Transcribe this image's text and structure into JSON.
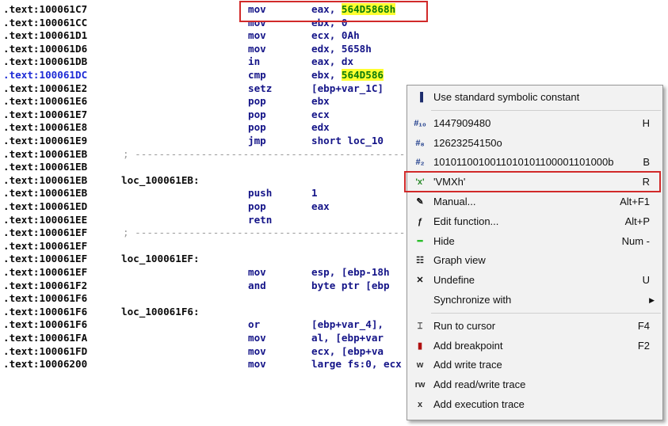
{
  "listing": [
    {
      "addr": ".text:100061C7",
      "mnem": "mov",
      "ops": "eax, ",
      "imm": "564D5868h",
      "hl": true
    },
    {
      "addr": ".text:100061CC",
      "mnem": "mov",
      "ops": "ebx, 0"
    },
    {
      "addr": ".text:100061D1",
      "mnem": "mov",
      "ops": "ecx, 0Ah"
    },
    {
      "addr": ".text:100061D6",
      "mnem": "mov",
      "ops": "edx, 5658h"
    },
    {
      "addr": ".text:100061DB",
      "mnem": "in",
      "ops": "eax, dx"
    },
    {
      "addr": ".text:100061DC",
      "mnem": "cmp",
      "ops": "ebx, ",
      "imm": "564D586",
      "hl": true,
      "current": true
    },
    {
      "addr": ".text:100061E2",
      "mnem": "setz",
      "ops": "[ebp+var_1C]"
    },
    {
      "addr": ".text:100061E6",
      "mnem": "pop",
      "ops": "ebx"
    },
    {
      "addr": ".text:100061E7",
      "mnem": "pop",
      "ops": "ecx"
    },
    {
      "addr": ".text:100061E8",
      "mnem": "pop",
      "ops": "edx"
    },
    {
      "addr": ".text:100061E9",
      "mnem": "jmp",
      "ops": "short loc_10"
    },
    {
      "addr": ".text:100061EB",
      "sep": "; ------------------------------------------------------"
    },
    {
      "addr": ".text:100061EB"
    },
    {
      "addr": ".text:100061EB",
      "label": "loc_100061EB:"
    },
    {
      "addr": ".text:100061EB",
      "mnem": "push",
      "ops": "1"
    },
    {
      "addr": ".text:100061ED",
      "mnem": "pop",
      "ops": "eax"
    },
    {
      "addr": ".text:100061EE",
      "mnem": "retn"
    },
    {
      "addr": ".text:100061EF",
      "sep": "; ------------------------------------------------------"
    },
    {
      "addr": ".text:100061EF"
    },
    {
      "addr": ".text:100061EF",
      "label": "loc_100061EF:"
    },
    {
      "addr": ".text:100061EF",
      "mnem": "mov",
      "ops": "esp, [ebp-18h"
    },
    {
      "addr": ".text:100061F2",
      "mnem": "and",
      "ops": "byte ptr [ebp"
    },
    {
      "addr": ".text:100061F6"
    },
    {
      "addr": ".text:100061F6",
      "label": "loc_100061F6:"
    },
    {
      "addr": ".text:100061F6",
      "mnem": "or",
      "ops": "[ebp+var_4], "
    },
    {
      "addr": ".text:100061FA",
      "mnem": "mov",
      "ops": "al, [ebp+var"
    },
    {
      "addr": ".text:100061FD",
      "mnem": "mov",
      "ops": "ecx, [ebp+va"
    },
    {
      "addr": ".text:10006200",
      "mnem": "mov",
      "ops": "large fs:0, ecx"
    }
  ],
  "menu": {
    "items": [
      {
        "name": "use-standard-symbolic-constant",
        "icon": "symbolic-constant-icon",
        "glyph": "▐",
        "color": "#1c2c6c",
        "label": "Use standard symbolic constant",
        "shortcut": ""
      },
      {
        "sep": true
      },
      {
        "name": "decimal",
        "icon": "decimal-icon",
        "glyph": "#₁₀",
        "color": "#1c3a8a",
        "label": "1447909480",
        "shortcut": "H"
      },
      {
        "name": "octal",
        "icon": "octal-icon",
        "glyph": "#₈",
        "color": "#1c3a8a",
        "label": "12623254150o",
        "shortcut": ""
      },
      {
        "name": "binary",
        "icon": "binary-icon",
        "glyph": "#₂",
        "color": "#1c3a8a",
        "label": "1010110010011010101100001101000b",
        "shortcut": "B"
      },
      {
        "name": "char",
        "icon": "char-icon",
        "glyph": "'x'",
        "color": "#2a8a2a",
        "label": "'VMXh'",
        "shortcut": "R"
      },
      {
        "name": "manual",
        "icon": "pencil-icon",
        "glyph": "✎",
        "color": "#111111",
        "label": "Manual...",
        "shortcut": "Alt+F1"
      },
      {
        "name": "edit-function",
        "icon": "function-icon",
        "glyph": "ƒ",
        "color": "#111111",
        "label": "Edit function...",
        "shortcut": "Alt+P"
      },
      {
        "name": "hide",
        "icon": "hide-icon",
        "glyph": "━",
        "color": "#22bb22",
        "label": "Hide",
        "shortcut": "Num -"
      },
      {
        "name": "graph-view",
        "icon": "graph-icon",
        "glyph": "☷",
        "color": "#111111",
        "label": "Graph view",
        "shortcut": ""
      },
      {
        "name": "undefine",
        "icon": "undefine-icon",
        "glyph": "✕",
        "color": "#111111",
        "label": "Undefine",
        "shortcut": "U"
      },
      {
        "name": "synchronize-with",
        "icon": "",
        "glyph": "",
        "color": "#111111",
        "label": "Synchronize with",
        "shortcut": "",
        "submenu": true
      },
      {
        "sep": true
      },
      {
        "name": "run-to-cursor",
        "icon": "run-to-cursor-icon",
        "glyph": "⌶",
        "color": "#333333",
        "label": "Run to cursor",
        "shortcut": "F4"
      },
      {
        "name": "add-breakpoint",
        "icon": "breakpoint-icon",
        "glyph": "▮",
        "color": "#b01010",
        "label": "Add breakpoint",
        "shortcut": "F2"
      },
      {
        "name": "add-write-trace",
        "icon": "write-trace-icon",
        "glyph": "w",
        "color": "#333333",
        "label": "Add write trace",
        "shortcut": ""
      },
      {
        "name": "add-read-write-trace",
        "icon": "read-write-trace-icon",
        "glyph": "rw",
        "color": "#333333",
        "label": "Add read/write trace",
        "shortcut": ""
      },
      {
        "name": "add-execution-trace",
        "icon": "execution-trace-icon",
        "glyph": "x",
        "color": "#333333",
        "label": "Add execution trace",
        "shortcut": ""
      }
    ]
  },
  "colors": {
    "highlight": "#ffff30",
    "annotation": "#d12a2a",
    "current_address": "#1d2bd6"
  }
}
